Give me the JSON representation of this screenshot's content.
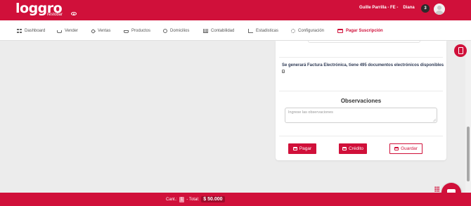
{
  "brand": {
    "logo_text": "loggro",
    "logo_sub": "restobar",
    "accent": "#d0103a"
  },
  "header": {
    "user_name": "Guille Parrilla - FE -",
    "user_role": "Diana",
    "notification_count": "3"
  },
  "nav": {
    "items": [
      {
        "label": "Dashboard",
        "icon": "grid-icon"
      },
      {
        "label": "Vender",
        "icon": "cart-icon"
      },
      {
        "label": "Ventas",
        "icon": "tag-icon"
      },
      {
        "label": "Productos",
        "icon": "basket-icon"
      },
      {
        "label": "Domicilios",
        "icon": "bike-icon"
      },
      {
        "label": "Contabilidad",
        "icon": "bank-icon"
      },
      {
        "label": "Estadisticas",
        "icon": "chart-line-icon"
      },
      {
        "label": "Configuración",
        "icon": "gear-icon"
      },
      {
        "label": "Pagar Suscripción",
        "icon": "credit-card-icon",
        "active": true
      }
    ]
  },
  "invoice": {
    "message": "Se generará Factura Electrónica, tiene 495 documentos electrónicos disponibles"
  },
  "observations": {
    "title": "Observaciones",
    "placeholder": "Ingrese las observaciones",
    "value": ""
  },
  "actions": {
    "pay_label": "Pagar",
    "credit_label": "Crédito",
    "save_label": "Guardar"
  },
  "footer": {
    "quantity_label": "Cant.:",
    "quantity_value": "1",
    "total_label": "- Total:",
    "total_value": "$ 50.000"
  }
}
